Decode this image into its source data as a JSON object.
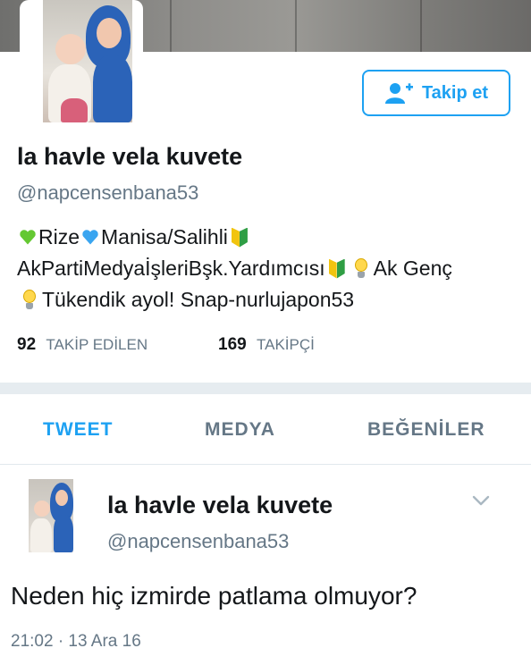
{
  "profile": {
    "name": "la havle vela kuvete",
    "handle": "@napcensenbana53",
    "follow_label": "Takip et",
    "bio": {
      "line1_a": "Rize",
      "line1_b": " Manisa/Salihli",
      "line2_a": "AkPartiMedyaİşleriBşk.Yardımcısı",
      "line2_b": "Ak Genç",
      "line3": "Tükendik ayol! Snap-nurlujapon53"
    },
    "following_count": "92",
    "following_label": "TAKİP EDİLEN",
    "followers_count": "169",
    "followers_label": "TAKİPÇİ"
  },
  "tabs": [
    {
      "label": "TWEET",
      "active": true
    },
    {
      "label": "MEDYA",
      "active": false
    },
    {
      "label": "BEĞENİLER",
      "active": false
    }
  ],
  "tweet": {
    "name": "la havle vela kuvete",
    "handle": "@napcensenbana53",
    "text": "Neden hiç izmirde patlama olmuyor?",
    "timestamp": "21:02 · 13 Ara 16"
  },
  "colors": {
    "accent": "#1da1f2",
    "muted": "#657786",
    "divider": "#e6ecf0"
  },
  "icons": [
    "follow-user-icon",
    "green-heart-icon",
    "blue-heart-icon",
    "beginner-shield-icon",
    "light-bulb-icon",
    "chevron-down-icon"
  ]
}
